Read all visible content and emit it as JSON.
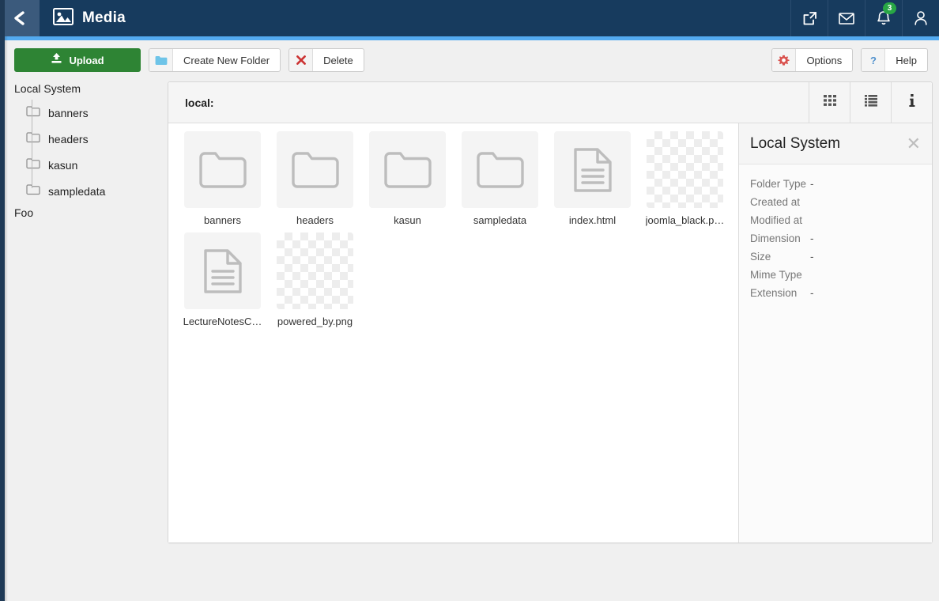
{
  "header": {
    "back_icon": "chevron-left-icon",
    "app_icon": "image-icon",
    "title": "Media",
    "icons": [
      {
        "name": "external-link-icon",
        "glyph": "external-link"
      },
      {
        "name": "mail-icon",
        "glyph": "mail"
      },
      {
        "name": "bell-icon",
        "glyph": "bell",
        "badge": "3"
      },
      {
        "name": "user-icon",
        "glyph": "user"
      }
    ]
  },
  "toolbar": {
    "upload_label": "Upload",
    "upload_icon": "upload-icon",
    "create_folder_label": "Create New Folder",
    "create_folder_icon": "folder-icon",
    "delete_label": "Delete",
    "delete_icon": "remove-x-icon",
    "options_label": "Options",
    "options_icon": "gear-icon",
    "help_label": "Help",
    "help_icon": "question-mark-icon"
  },
  "sidebar": {
    "root_label": "Local System",
    "items": [
      {
        "label": "banners",
        "icon": "folder-icon"
      },
      {
        "label": "headers",
        "icon": "folder-icon"
      },
      {
        "label": "kasun",
        "icon": "folder-icon"
      },
      {
        "label": "sampledata",
        "icon": "folder-icon"
      }
    ],
    "tail_label": "Foo"
  },
  "panel": {
    "path": "local:",
    "views": [
      {
        "name": "grid-view-button",
        "icon": "grid-icon"
      },
      {
        "name": "list-view-button",
        "icon": "list-icon"
      },
      {
        "name": "info-toggle-button",
        "icon": "info-icon"
      }
    ],
    "media": [
      {
        "name": "banners",
        "kind": "folder"
      },
      {
        "name": "headers",
        "kind": "folder"
      },
      {
        "name": "kasun",
        "kind": "folder"
      },
      {
        "name": "sampledata",
        "kind": "folder"
      },
      {
        "name": "index.html",
        "kind": "file"
      },
      {
        "name": "joomla_black.p…",
        "kind": "image"
      },
      {
        "name": "LectureNotesC…",
        "kind": "file"
      },
      {
        "name": "powered_by.png",
        "kind": "image"
      }
    ]
  },
  "info": {
    "title": "Local System",
    "close_icon": "close-icon",
    "rows": [
      {
        "label": "Folder Type",
        "value": "-"
      },
      {
        "label": "Created at",
        "value": ""
      },
      {
        "label": "Modified at",
        "value": ""
      },
      {
        "label": "Dimension",
        "value": "-"
      },
      {
        "label": "Size",
        "value": "-"
      },
      {
        "label": "Mime Type",
        "value": ""
      },
      {
        "label": "Extension",
        "value": "-"
      }
    ]
  },
  "colors": {
    "header_bg": "#173b5e",
    "back_bg": "#3b5a7c",
    "accent": "#53aaf0",
    "primary_green": "#2e8434",
    "badge_green": "#28a745",
    "danger_red": "#cc3333",
    "info_blue": "#5091cd",
    "folder_blue": "#6ec4e8"
  }
}
